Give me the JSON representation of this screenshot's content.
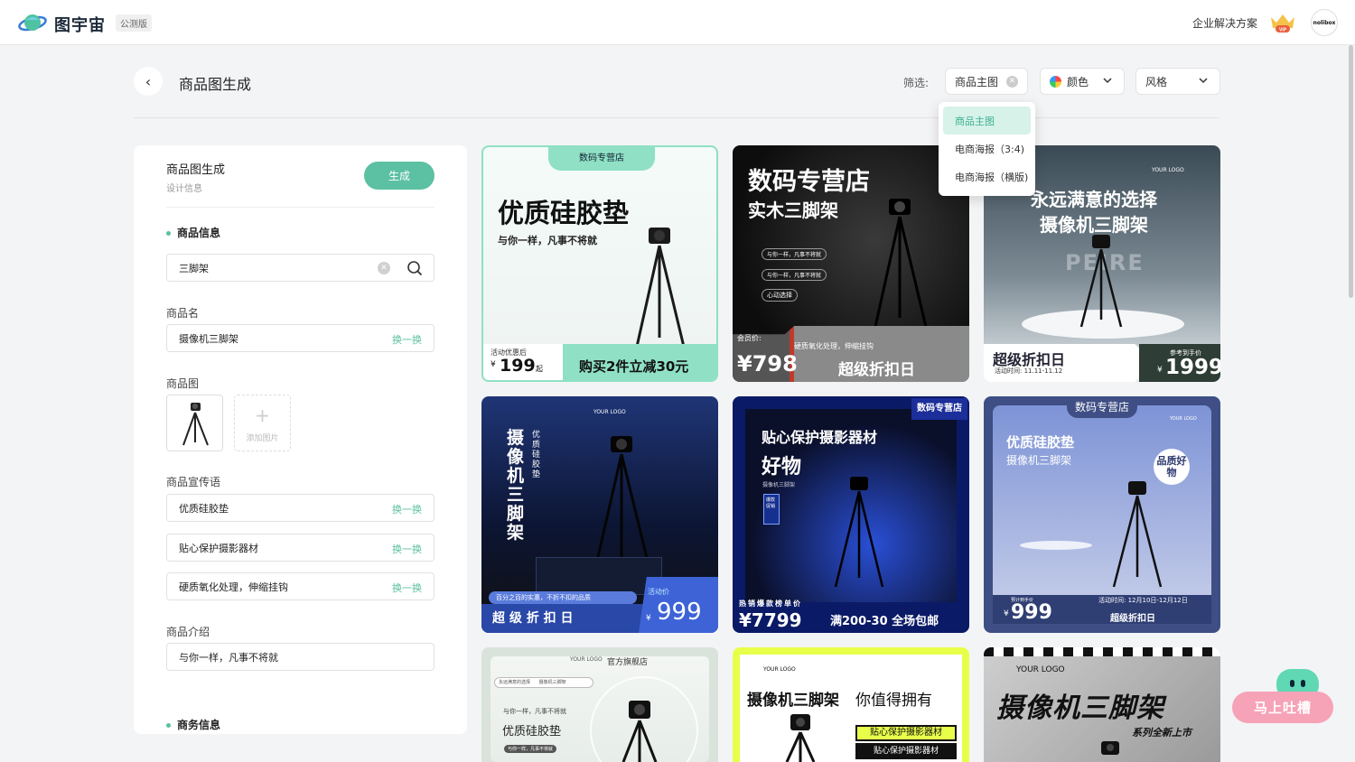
{
  "topbar": {
    "brand": "图宇宙",
    "badge": "公测版",
    "enterprise_link": "企业解决方案",
    "vip_label": "VIP",
    "avatar_text": "nolibox"
  },
  "header": {
    "back_icon": "chevron-left-icon",
    "title": "商品图生成",
    "filter_label": "筛选:",
    "filters": [
      {
        "label": "商品主图"
      },
      {
        "label": "颜色"
      },
      {
        "label": "风格"
      }
    ],
    "dropdown_options": [
      "商品主图",
      "电商海报（3:4)",
      "电商海报（横版)"
    ]
  },
  "panel": {
    "title": "商品图生成",
    "subtitle": "设计信息",
    "generate_button": "生成",
    "product_section": "商品信息",
    "search_value": "三脚架",
    "name_label": "商品名",
    "name_value": "摄像机三脚架",
    "swap_label": "换一换",
    "image_label": "商品图",
    "add_image": "添加图片",
    "slogan_label": "商品宣传语",
    "slogans": [
      "优质硅胶垫",
      "贴心保护摄影器材",
      "硬质氧化处理，伸缩挂钩"
    ],
    "intro_label": "商品介绍",
    "intro_value": "与你一样，凡事不将就",
    "business_section": "商务信息"
  },
  "cards": {
    "c1": {
      "tag": "数码专营店",
      "headline": "优质硅胶垫",
      "sub": "与你一样，凡事不将就",
      "promo_label": "活动优惠后",
      "price": "199",
      "price_suffix": "起",
      "offer": "购买2件立减30元"
    },
    "c2": {
      "headline1": "数码专营店",
      "headline2": "实木三脚架",
      "pill1": "与你一样，凡事不将就",
      "pill2": "与你一样，凡事不将就",
      "pill3": "心动选择",
      "member_label": "会员价:",
      "price": "¥798",
      "desc": "硬质氧化处理，伸缩挂钩",
      "promo": "超级折扣日"
    },
    "c3": {
      "logo": "YOUR LOGO",
      "headline1": "永远满意的选择",
      "headline2": "摄像机三脚架",
      "bg_word": "PEIRE",
      "promo": "超级折扣日",
      "date": "活动时间: 11.11-11.12",
      "ref_label": "参考到手价",
      "price": "1999"
    },
    "c4": {
      "logo": "YOUR LOGO",
      "vertical_title": "摄像机三脚架",
      "vertical_sub": "优质硅胶垫",
      "banner": "百分之百的实惠，不折不扣的品质",
      "promo": "超 级 折 扣 日",
      "event": "活动价",
      "price": "999"
    },
    "c5": {
      "tag": "数码专营店",
      "headline1": "贴心保护摄影器材",
      "headline2": "好物",
      "sub": "摄像机三脚架",
      "badge": "爆款促销",
      "hot": "热销爆款榜单价",
      "price": "¥7799",
      "offer": "满200-30 全场包邮"
    },
    "c6": {
      "tag": "数码专营店",
      "logo": "YOUR LOGO",
      "headline1": "优质硅胶垫",
      "headline2": "摄像机三脚架",
      "badge": "品质好物",
      "est_label": "预计到手价",
      "price": "999",
      "date": "活动时间: 12月10日-12月12日",
      "promo": "超级折扣日"
    },
    "c7": {
      "logo": "YOUR LOGO",
      "store": "官方旗舰店",
      "search_left": "永远满意的选择",
      "search_right": "摄像机三脚架",
      "sub": "与你一样，凡事不将就",
      "headline": "优质硅胶垫",
      "pill": "与你一样，凡事不将就"
    },
    "c8": {
      "logo": "YOUR LOGO",
      "headline": "摄像机三脚架",
      "headline_b": "你值得拥有",
      "tag1": "贴心保护摄影器材",
      "tag2": "贴心保护摄影器材"
    },
    "c9": {
      "logo": "YOUR LOGO",
      "headline": "摄像机三脚架",
      "sub": "系列全新上市"
    }
  },
  "feedback": {
    "label": "马上吐槽"
  },
  "colors": {
    "accent": "#5cc0a2",
    "navy": "#2c3e87",
    "lime": "#e8ff4a"
  }
}
